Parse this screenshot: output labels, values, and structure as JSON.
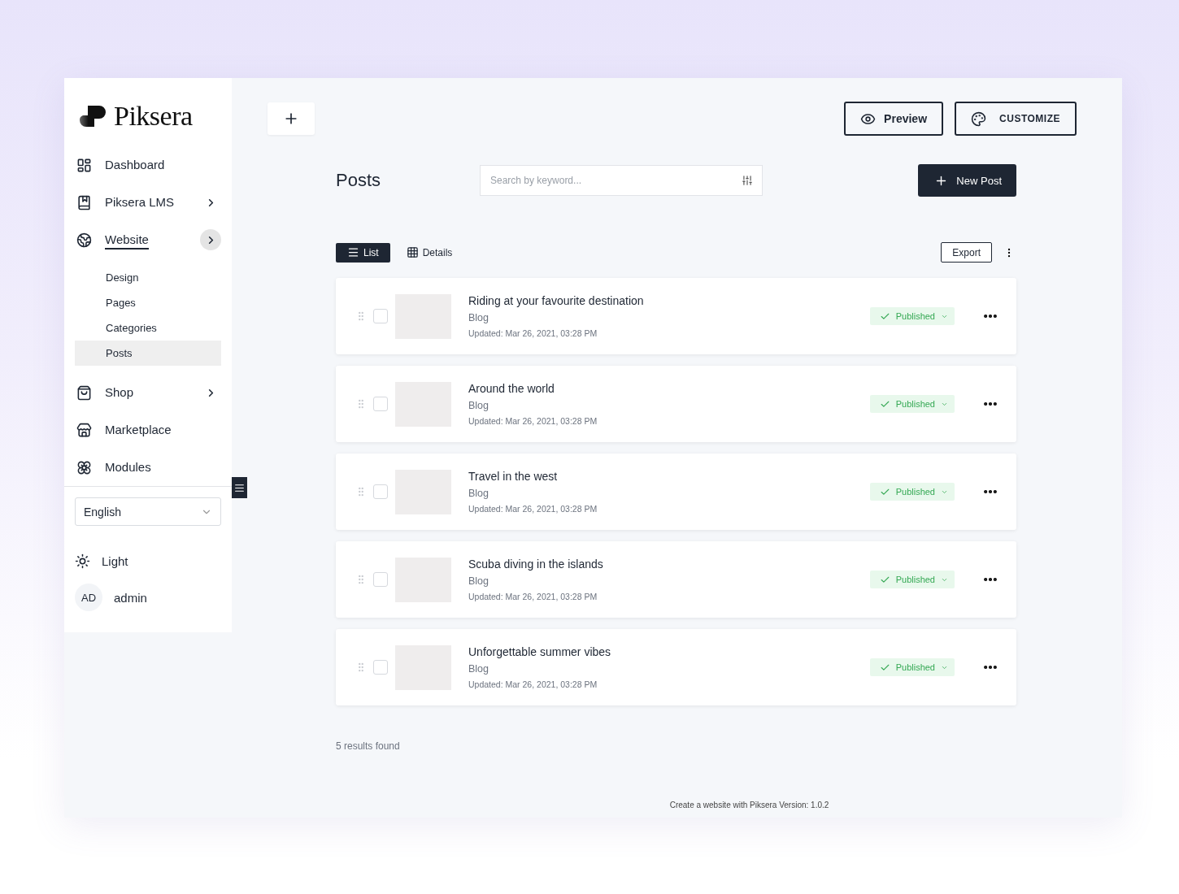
{
  "brand": {
    "name": "Piksera"
  },
  "sidebar": {
    "items": [
      {
        "label": "Dashboard",
        "kind": "link",
        "selected": false
      },
      {
        "label": "Piksera LMS",
        "kind": "group",
        "selected": false,
        "expanded": false
      },
      {
        "label": "Website",
        "kind": "group",
        "selected": true,
        "expanded": true,
        "children": [
          {
            "label": "Design",
            "selected": false
          },
          {
            "label": "Pages",
            "selected": false
          },
          {
            "label": "Categories",
            "selected": false
          },
          {
            "label": "Posts",
            "selected": true
          }
        ]
      },
      {
        "label": "Shop",
        "kind": "group",
        "selected": false,
        "expanded": false
      },
      {
        "label": "Marketplace",
        "kind": "link",
        "selected": false
      },
      {
        "label": "Modules",
        "kind": "link",
        "selected": false
      }
    ],
    "language": {
      "value": "English"
    },
    "theme": {
      "label": "Light"
    },
    "user": {
      "initials": "AD",
      "name": "admin"
    }
  },
  "header": {
    "buttons": [
      {
        "label": "Preview",
        "kind": "preview"
      },
      {
        "label": "CUSTOMIZE",
        "kind": "customize"
      }
    ]
  },
  "page": {
    "title": "Posts",
    "search": {
      "placeholder": "Search by keyword..."
    },
    "new_button": "New Post"
  },
  "views": [
    {
      "label": "List",
      "selected": true
    },
    {
      "label": "Details",
      "selected": false
    }
  ],
  "export": "Export",
  "posts": [
    {
      "title": "Riding at your favourite destination",
      "category": "Blog",
      "updated": "Updated: Mar 26, 2021, 03:28 PM",
      "status": "Published",
      "checked": false
    },
    {
      "title": "Around the world",
      "category": "Blog",
      "updated": "Updated: Mar 26, 2021, 03:28 PM",
      "status": "Published",
      "checked": false
    },
    {
      "title": "Travel in the west",
      "category": "Blog",
      "updated": "Updated: Mar 26, 2021, 03:28 PM",
      "status": "Published",
      "checked": false
    },
    {
      "title": "Scuba diving in the islands",
      "category": "Blog",
      "updated": "Updated: Mar 26, 2021, 03:28 PM",
      "status": "Published",
      "checked": false
    },
    {
      "title": "Unforgettable summer vibes",
      "category": "Blog",
      "updated": "Updated: Mar 26, 2021, 03:28 PM",
      "status": "Published",
      "checked": false
    }
  ],
  "results": "5 results found",
  "footer": "Create a website with Piksera Version: 1.0.2"
}
